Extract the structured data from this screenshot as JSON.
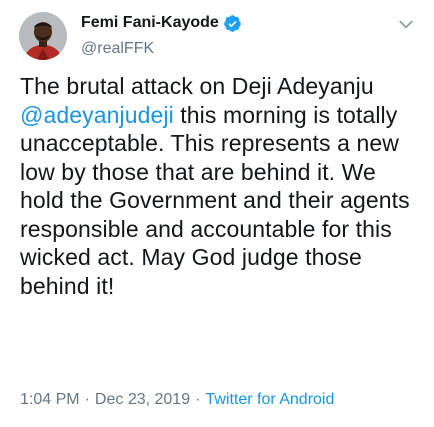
{
  "author": {
    "display_name": "Femi Fani-Kayode",
    "handle": "@realFFK",
    "verified": true,
    "avatar_icon": "profile-photo",
    "verified_icon": "verified-badge-icon",
    "verified_color": "#1da1f2"
  },
  "tweet": {
    "text_before_mention": "The brutal attack on Deji Adeyanju ",
    "mention": "@adeyanjudeji",
    "text_after_mention": " this morning is totally unacceptable. This represents a new low by those that are behind it. We hold the Government and their agents responsible and accountable for this wicked act. May God judge those behind it!"
  },
  "meta": {
    "time": "1:04 PM",
    "separator_1": "·",
    "date": "Dec 23, 2019",
    "separator_2": "·",
    "source": "Twitter for Android"
  },
  "menu": {
    "icon": "chevron-down-icon"
  },
  "colors": {
    "link": "#1b95e0",
    "text": "#14171a",
    "secondary": "#657786"
  }
}
